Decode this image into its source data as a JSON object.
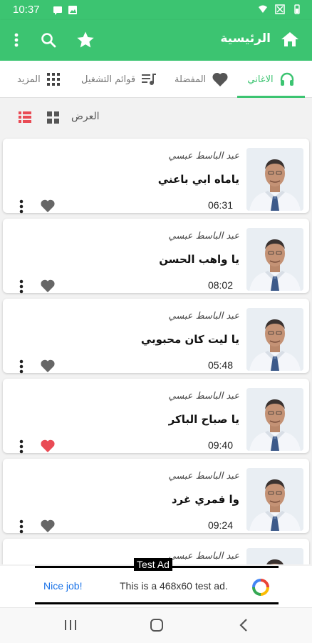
{
  "status": {
    "time": "10:37"
  },
  "appbar": {
    "title": "الرئيسية"
  },
  "tabs": [
    {
      "label": "الاغاني",
      "active": true
    },
    {
      "label": "المفضلة",
      "active": false
    },
    {
      "label": "قوائم التشغيل",
      "active": false
    },
    {
      "label": "المزيد",
      "active": false
    }
  ],
  "view": {
    "label": "العرض"
  },
  "songs": [
    {
      "artist": "عبد الباسط عبسي",
      "title": "ياماه ابي باعني",
      "duration": "06:31",
      "favorite": false
    },
    {
      "artist": "عبد الباسط عبسي",
      "title": "يا واهب الحسن",
      "duration": "08:02",
      "favorite": false
    },
    {
      "artist": "عبد الباسط عبسي",
      "title": "يا ليت كان محبوبي",
      "duration": "05:48",
      "favorite": false
    },
    {
      "artist": "عبد الباسط عبسي",
      "title": "يا صباح الباكر",
      "duration": "09:40",
      "favorite": true
    },
    {
      "artist": "عبد الباسط عبسي",
      "title": "وا قمري غرد",
      "duration": "09:24",
      "favorite": false
    },
    {
      "artist": "عبد الباسط عبسي",
      "title": "",
      "duration": "",
      "favorite": false
    }
  ],
  "ad": {
    "tag": "Test Ad",
    "cta": "Nice job!",
    "text": "This is a 468x60 test ad."
  },
  "colors": {
    "accent": "#3cc471",
    "favorite": "#e94b55",
    "icon_gray": "#666666"
  }
}
